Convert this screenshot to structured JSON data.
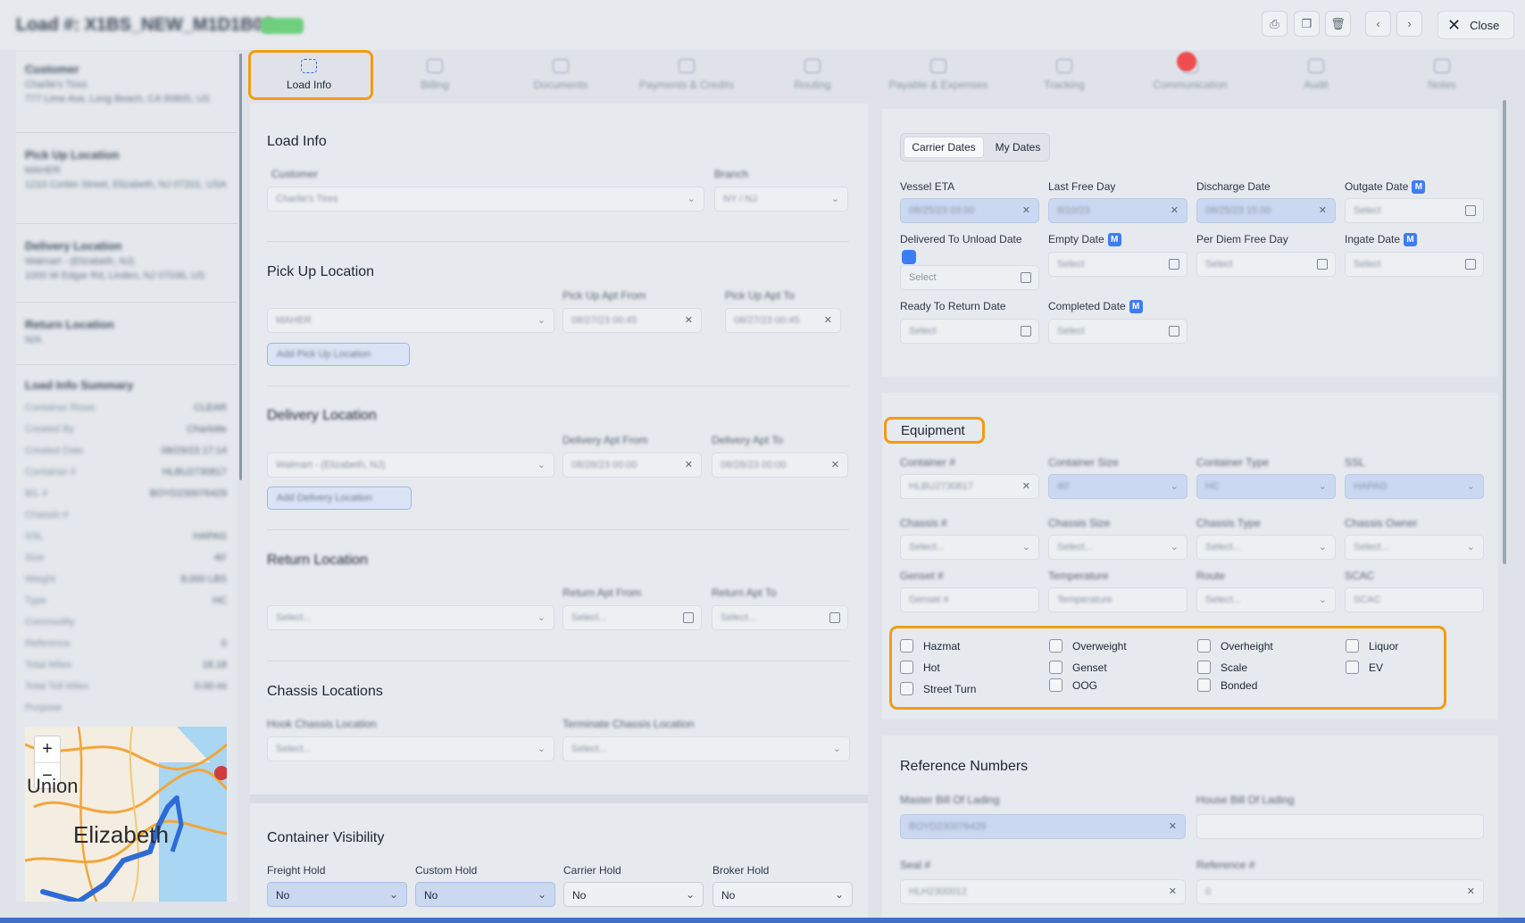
{
  "header": {
    "load_title": "Load #: X1BS_NEW_M1D1B03",
    "status_badge": "",
    "close_label": "Close",
    "actions": [
      "print-icon",
      "copy-icon",
      "delete-icon",
      "chevron-left-icon",
      "chevron-right-icon"
    ]
  },
  "sidebar": {
    "customer_heading": "Customer",
    "customer_name": "Charlie's Tires",
    "customer_address": "777 Lime Ave, Long Beach, CA 90805, US",
    "pickup_heading": "Pick Up Location",
    "pickup_name": "MAHER",
    "pickup_address": "1210 Corbin Street, Elizabeth, NJ 07201, USA",
    "delivery_heading": "Delivery Location",
    "delivery_name": "Walmart - (Elizabeth, NJ)",
    "delivery_address": "1000 W Edgar Rd, Linden, NJ 07036, US",
    "return_heading": "Return Location",
    "return_value": "N/A",
    "summary_heading": "Load Info Summary",
    "summary_rows": [
      {
        "label": "Container Rows",
        "value": "CLEAR"
      },
      {
        "label": "Created By",
        "value": "Charlotte"
      },
      {
        "label": "Created Date",
        "value": "08/29/23 17:14"
      },
      {
        "label": "Container #",
        "value": "HLBU2730817"
      },
      {
        "label": "B/L #",
        "value": "BOYD230076429"
      },
      {
        "label": "Chassis #",
        "value": ""
      },
      {
        "label": "SSL",
        "value": "HAPAG"
      },
      {
        "label": "Size",
        "value": "40'"
      },
      {
        "label": "Weight",
        "value": "8,000 LBS"
      },
      {
        "label": "Type",
        "value": "HC"
      },
      {
        "label": "Commodity",
        "value": ""
      },
      {
        "label": "Reference",
        "value": "0"
      },
      {
        "label": "Total Miles",
        "value": "18.18"
      },
      {
        "label": "Total Toll Miles",
        "value": "0.00 mi"
      },
      {
        "label": "Purpose",
        "value": ""
      }
    ],
    "map": {
      "zoom_in": "+",
      "zoom_out": "−",
      "label_a": "Union",
      "label_b": "Elizabeth"
    }
  },
  "tabs": [
    {
      "label": "Load Info",
      "icon": "scan-icon"
    },
    {
      "label": "Billing",
      "icon": "billing-icon"
    },
    {
      "label": "Documents",
      "icon": "document-icon"
    },
    {
      "label": "Payments & Credits",
      "icon": "payment-icon"
    },
    {
      "label": "Routing",
      "icon": "routing-icon"
    },
    {
      "label": "Payable & Expenses",
      "icon": "truck-icon"
    },
    {
      "label": "Tracking",
      "icon": "location-icon"
    },
    {
      "label": "Communication",
      "icon": "chat-icon"
    },
    {
      "label": "Audit",
      "icon": "audit-icon"
    },
    {
      "label": "Notes",
      "icon": "notes-icon"
    }
  ],
  "load_info": {
    "title": "Load Info",
    "customer_label": "Customer",
    "customer_value": "Charlie's Tires",
    "branch_label": "Branch",
    "branch_value": "NY / NJ"
  },
  "pickup": {
    "title": "Pick Up Location",
    "from_label": "Pick Up Apt From",
    "to_label": "Pick Up Apt To",
    "location_value": "MAHER",
    "from_value": "08/27/23 00:45",
    "to_value": "08/27/23 00:45",
    "add_label": "Add Pick Up Location"
  },
  "delivery": {
    "title": "Delivery Location",
    "from_label": "Delivery Apt From",
    "to_label": "Delivery Apt To",
    "location_value": "Walmart - (Elizabeth, NJ)",
    "from_value": "08/28/23 00:00",
    "to_value": "08/28/23 00:00",
    "add_label": "Add Delivery Location"
  },
  "return": {
    "title": "Return Location",
    "from_label": "Return Apt From",
    "to_label": "Return Apt To",
    "location_placeholder": "Select...",
    "from_placeholder": "Select...",
    "to_placeholder": "Select..."
  },
  "chassis": {
    "title": "Chassis Locations",
    "hook_label": "Hook Chassis Location",
    "terminate_label": "Terminate Chassis Location",
    "hook_placeholder": "Select...",
    "terminate_placeholder": "Select..."
  },
  "visibility": {
    "title": "Container Visibility",
    "fields": [
      {
        "label": "Freight Hold",
        "value": "No"
      },
      {
        "label": "Custom Hold",
        "value": "No"
      },
      {
        "label": "Carrier Hold",
        "value": "No"
      },
      {
        "label": "Broker Hold",
        "value": "No"
      }
    ]
  },
  "dates": {
    "toggle": [
      "Carrier Dates",
      "My Dates"
    ],
    "vessel_eta_label": "Vessel ETA",
    "vessel_eta_value": "08/25/23 03:00",
    "last_free_day_label": "Last Free Day",
    "last_free_day_value": "8/10/23",
    "discharge_label": "Discharge Date",
    "discharge_value": "08/25/23 15:00",
    "outgate_label": "Outgate Date",
    "delivered_label": "Delivered To Unload Date",
    "empty_label": "Empty Date",
    "per_diem_label": "Per Diem Free Day",
    "ingate_label": "Ingate Date",
    "ready_label": "Ready To Return Date",
    "completed_label": "Completed Date",
    "m_badge": "M",
    "select_placeholder": "Select"
  },
  "equipment": {
    "title": "Equipment",
    "container_label": "Container #",
    "container_value": "HLBU2730817",
    "size_label": "Container Size",
    "size_value": "40'",
    "type_label": "Container Type",
    "type_value": "HC",
    "ssl_label": "SSL",
    "ssl_value": "HAPAG",
    "chassis_label": "Chassis #",
    "chassis_size_label": "Chassis Size",
    "chassis_type_label": "Chassis Type",
    "chassis_owner_label": "Chassis Owner",
    "genset_label": "Genset #",
    "temperature_label": "Temperature",
    "route_label": "Route",
    "scac_label": "SCAC",
    "select_placeholder": "Select...",
    "checkboxes": [
      "Hazmat",
      "Overweight",
      "Overheight",
      "Liquor",
      "Hot",
      "Genset",
      "Scale",
      "EV",
      "Street Turn",
      "OOG",
      "Bonded"
    ]
  },
  "reference": {
    "title": "Reference Numbers",
    "master_label": "Master Bill Of Lading",
    "master_value": "BOYD230076429",
    "house_label": "House Bill Of Lading",
    "seal_label": "Seal #",
    "seal_value": "HLH2300012",
    "reference_label": "Reference #",
    "reference_value": "0"
  }
}
